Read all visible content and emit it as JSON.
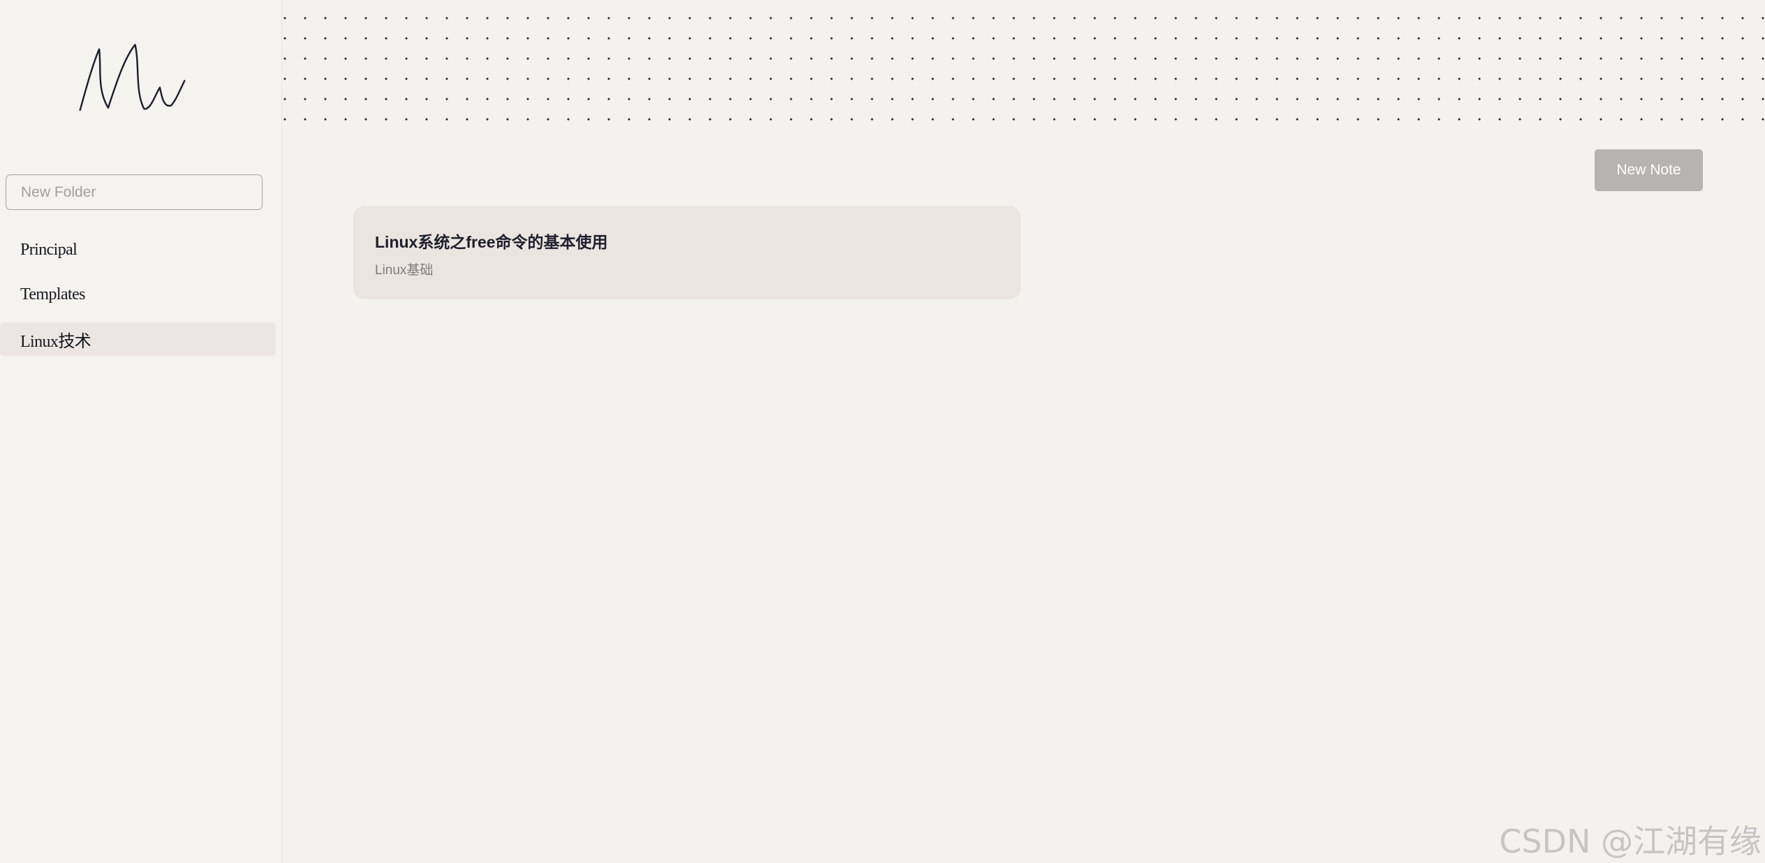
{
  "sidebar": {
    "new_folder_placeholder": "New Folder",
    "folders": [
      {
        "label": "Principal",
        "selected": false
      },
      {
        "label": "Templates",
        "selected": false
      },
      {
        "label": "Linux技术",
        "selected": true
      }
    ]
  },
  "toolbar": {
    "new_note_label": "New Note"
  },
  "notes": [
    {
      "title": "Linux系统之free命令的基本使用",
      "folder": "Linux基础"
    }
  ],
  "watermark": "CSDN @江湖有缘",
  "colors": {
    "background": "#f4f2ef",
    "selected_folder": "#ebe6e3",
    "note_card": "#ebe5e2",
    "button": "#b6b4b2",
    "text_dark": "#1d1f2a"
  }
}
